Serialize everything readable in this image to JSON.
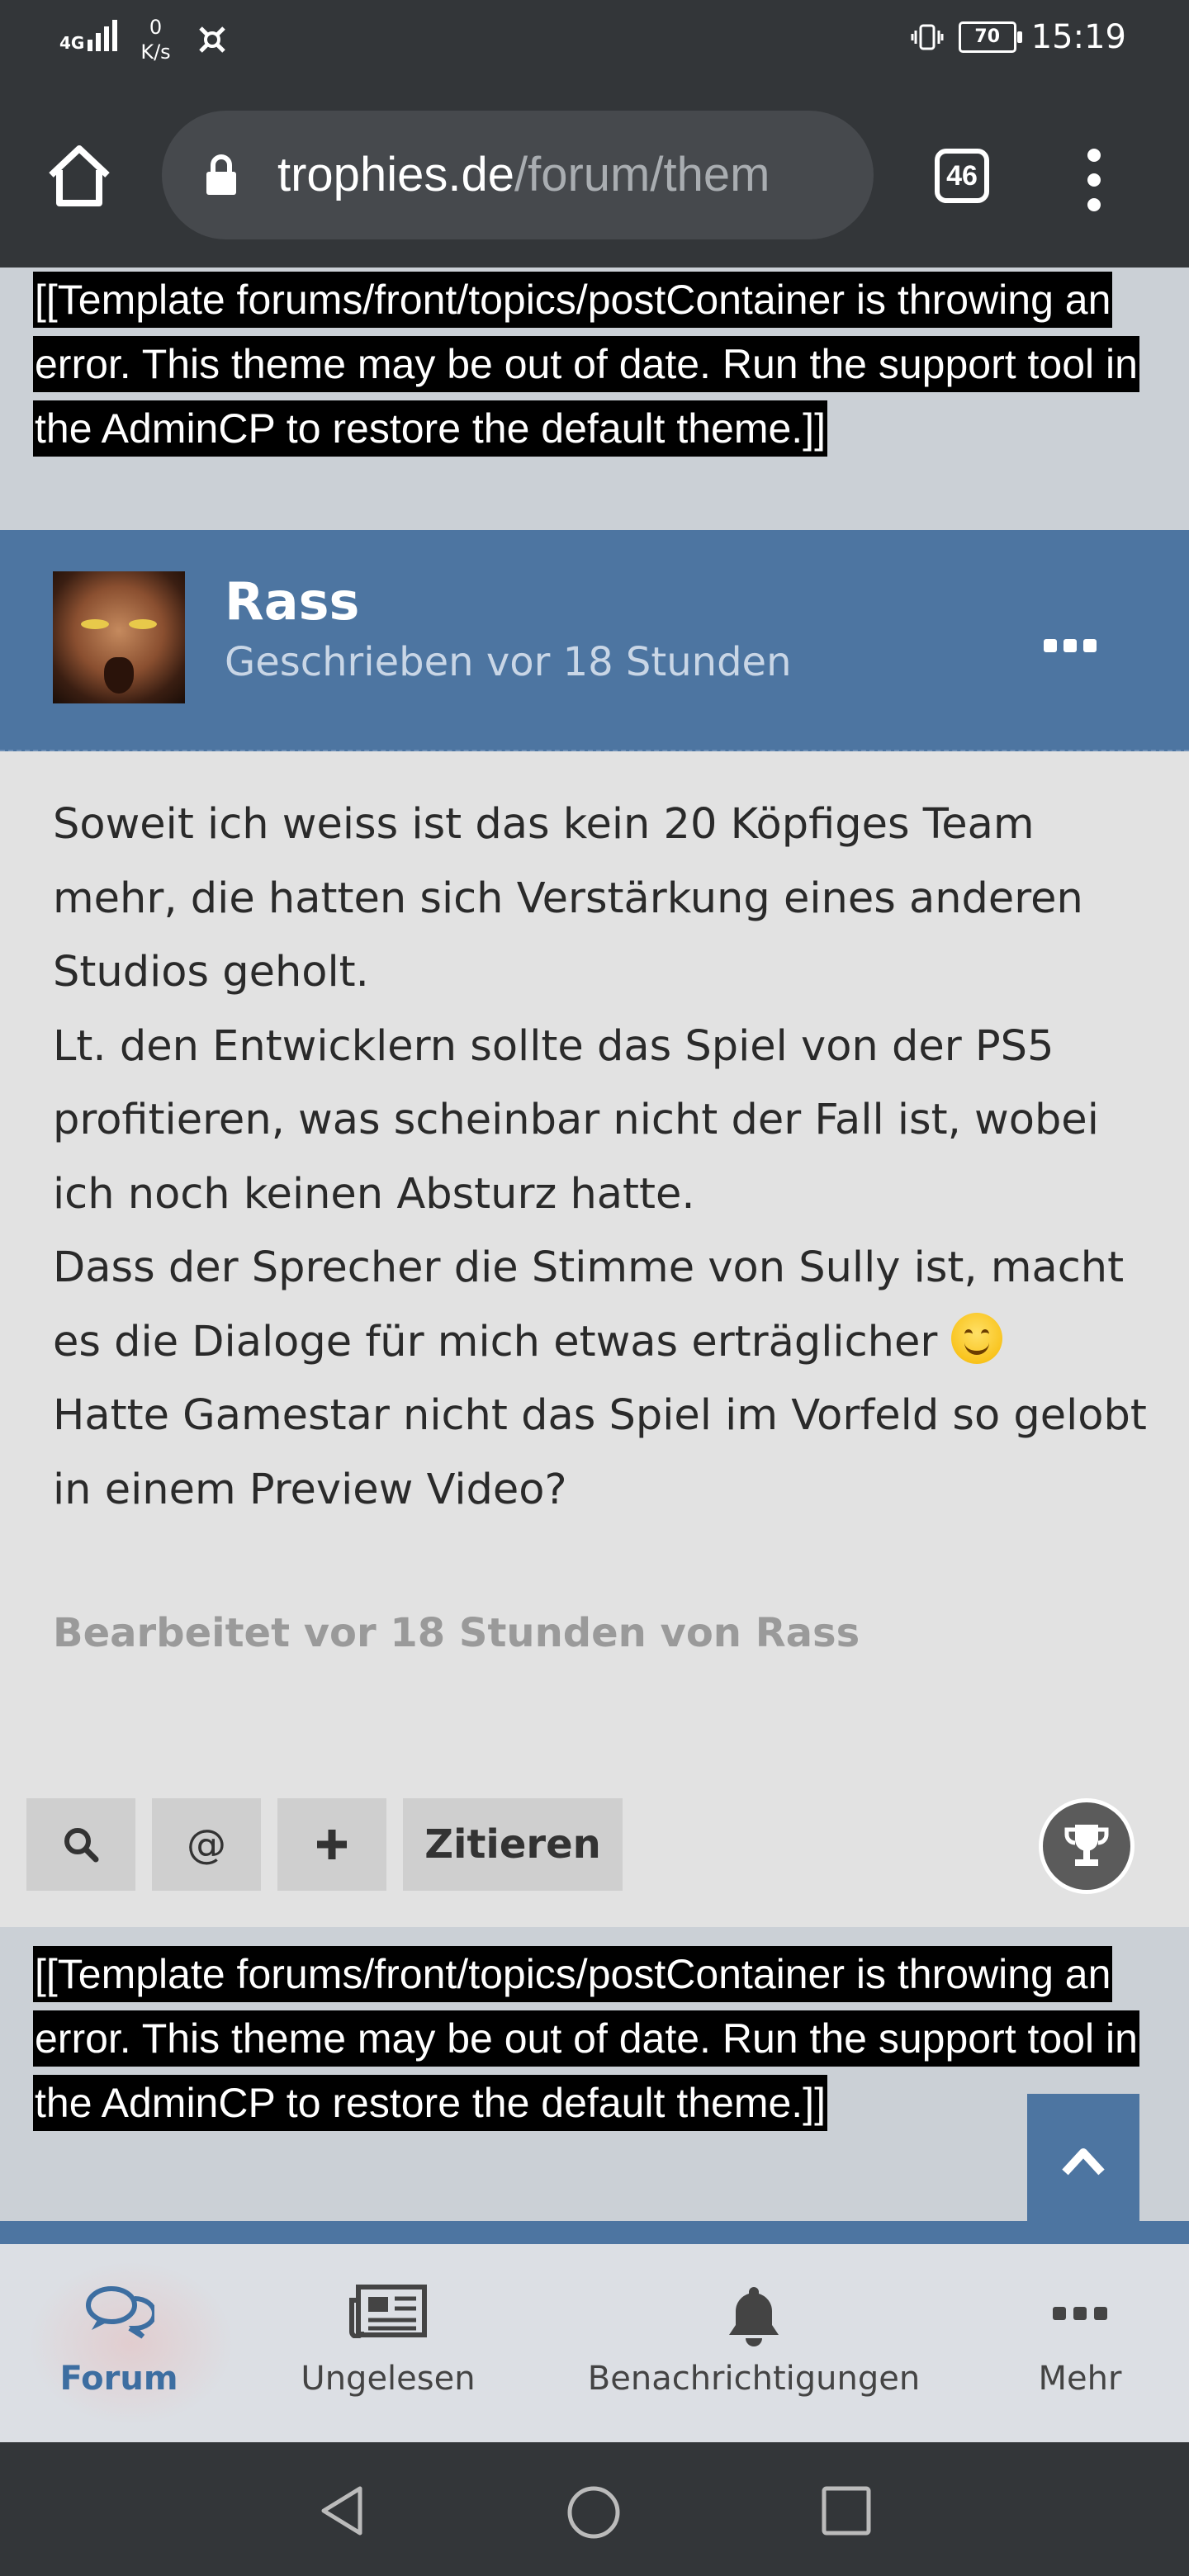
{
  "status_bar": {
    "network": "4G",
    "speed_value": "0",
    "speed_unit": "K/s",
    "battery": "70",
    "time": "15:19"
  },
  "browser": {
    "url_domain": "trophies.de",
    "url_path": "/forum/them",
    "tab_count": "46"
  },
  "error_message": "[[Template forums/front/topics/postContainer is throwing an error. This theme may be out of date. Run the support tool in the AdminCP to restore the default theme.]]",
  "post": {
    "author": "Rass",
    "written": "Geschrieben vor 18 Stunden",
    "paragraphs": [
      "Soweit ich weiss ist das kein 20 Köpfiges Team mehr, die hatten sich Verstärkung eines anderen Studios geholt.",
      "Lt. den Entwicklern sollte das Spiel von der PS5 profitieren, was scheinbar nicht der Fall ist, wobei ich noch keinen Absturz hatte.",
      "Dass der Sprecher die Stimme von Sully ist, macht es die Dialoge für mich etwas erträglicher",
      "Hatte Gamestar nicht das Spiel im Vorfeld so gelobt in einem Preview Video?"
    ],
    "edited": "Bearbeitet vor 18 Stunden von Rass",
    "actions": {
      "search": "🔍",
      "mention": "@",
      "add": "+",
      "quote": "Zitieren"
    }
  },
  "bottom_nav": [
    {
      "label": "Forum",
      "icon": "forum-icon",
      "active": true
    },
    {
      "label": "Ungelesen",
      "icon": "newspaper-icon",
      "active": false
    },
    {
      "label": "Benachrichtigungen",
      "icon": "bell-icon",
      "active": false
    },
    {
      "label": "Mehr",
      "icon": "more-icon",
      "active": false
    }
  ],
  "colors": {
    "accent": "#4d75a1",
    "chrome": "#333639"
  }
}
